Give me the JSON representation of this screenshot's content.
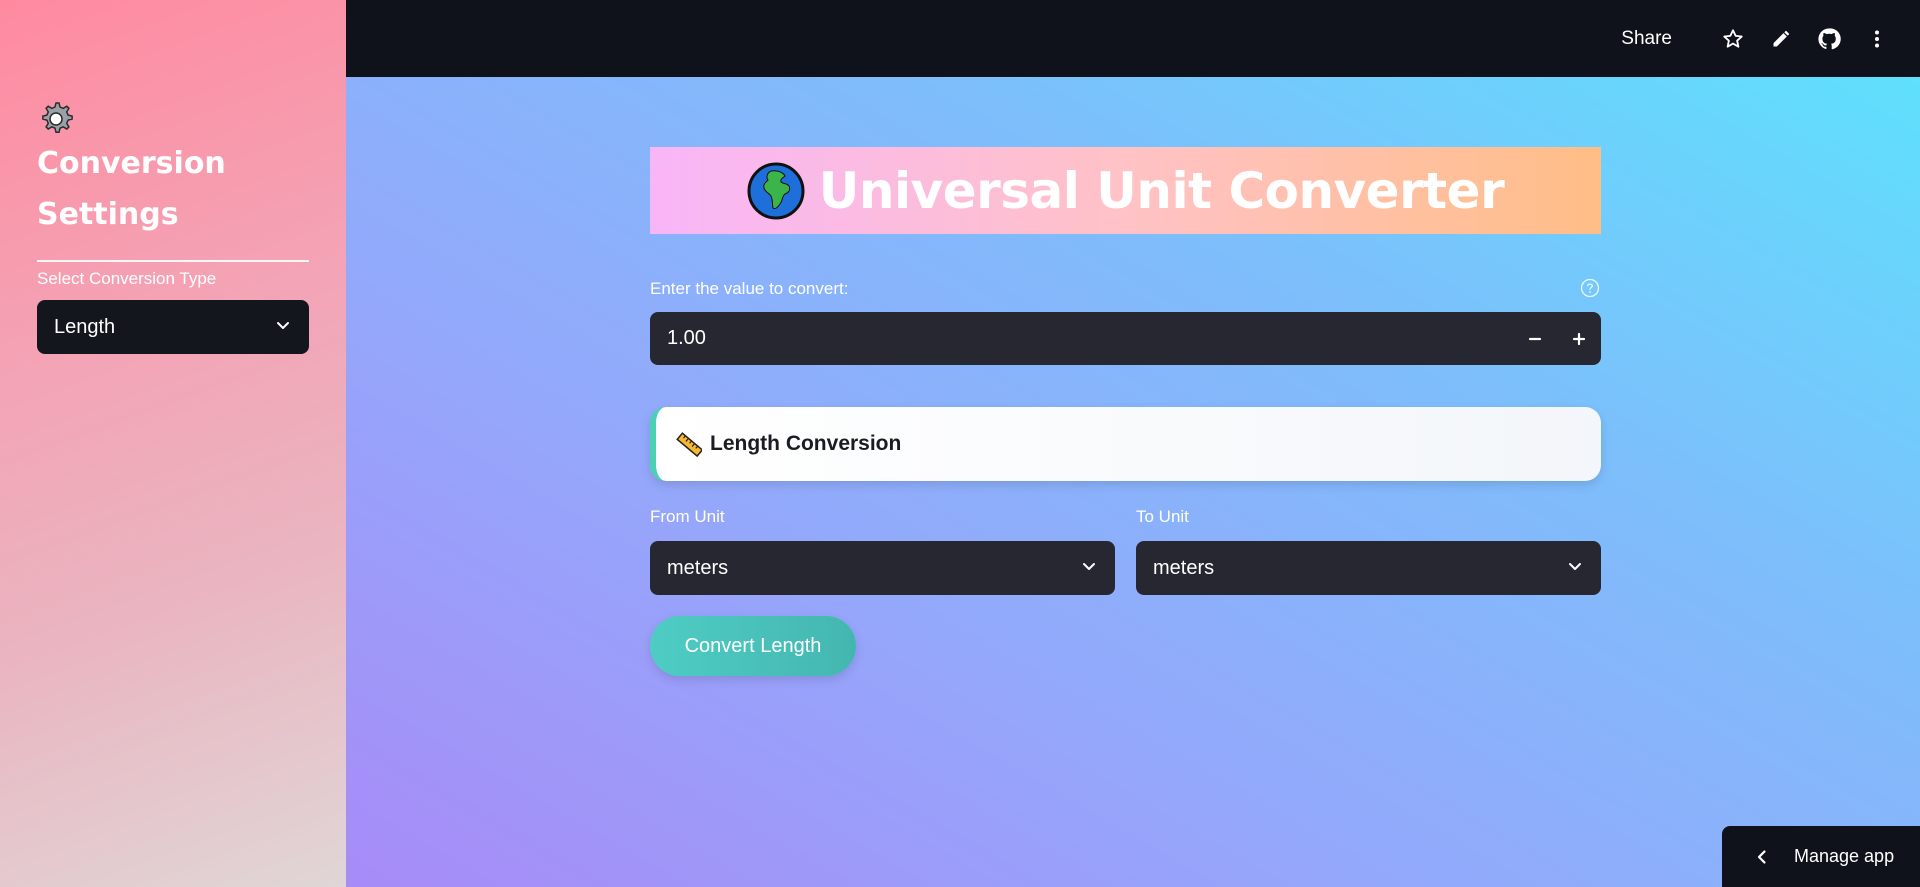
{
  "sidebar": {
    "title": "Conversion Settings",
    "select_label": "Select Conversion Type",
    "selected_type": "Length"
  },
  "topbar": {
    "share_label": "Share",
    "icons": [
      "star-icon",
      "pencil-icon",
      "github-icon",
      "more-vert-icon"
    ]
  },
  "main": {
    "header_title": "Universal Unit Converter",
    "value_label": "Enter the value to convert:",
    "value": "1.00",
    "section_title": "Length Conversion",
    "from_label": "From Unit",
    "from_value": "meters",
    "to_label": "To Unit",
    "to_value": "meters",
    "convert_label": "Convert Length"
  },
  "manage": {
    "label": "Manage app"
  },
  "colors": {
    "sidebar_gradient_top": "#ff8aa0",
    "main_gradient_start": "#a78bf7",
    "main_gradient_end": "#5fe0fc",
    "button_teal": "#4ecdc4",
    "input_bg": "#262730"
  }
}
